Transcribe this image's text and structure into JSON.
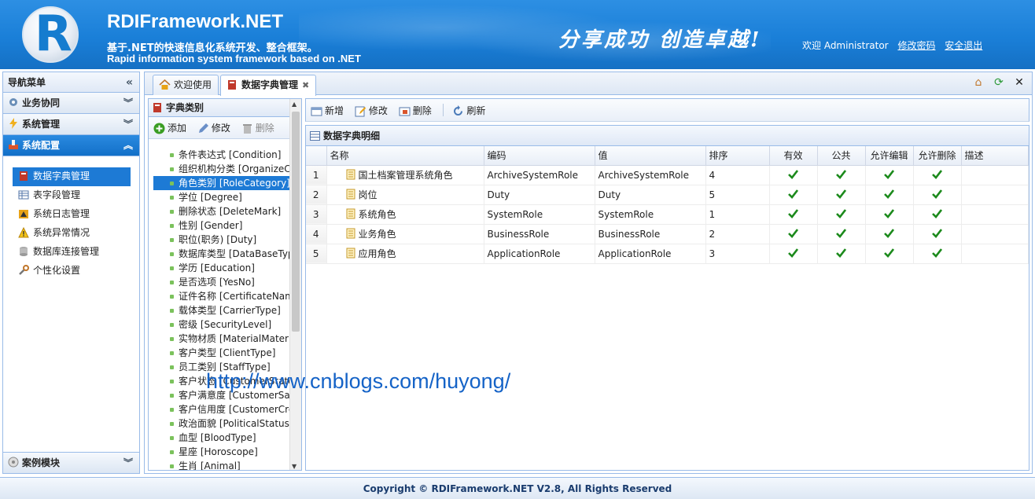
{
  "header": {
    "brand": "RDIFramework.NET",
    "tagline_cn": "基于.NET的快速信息化系统开发、整合框架。",
    "tagline_en": "Rapid information system framework based on .NET",
    "slogan": "分享成功  创造卓越!",
    "welcome": "欢迎 Administrator",
    "change_password": "修改密码",
    "logout": "安全退出"
  },
  "nav": {
    "title": "导航菜单",
    "sections": [
      {
        "label": "业务协同"
      },
      {
        "label": "系统管理"
      },
      {
        "label": "系统配置"
      }
    ],
    "items": [
      {
        "label": "数据字典管理"
      },
      {
        "label": "表字段管理"
      },
      {
        "label": "系统日志管理"
      },
      {
        "label": "系统异常情况"
      },
      {
        "label": "数据库连接管理"
      },
      {
        "label": "个性化设置"
      }
    ],
    "bottom_section": "案例模块"
  },
  "tabs": [
    {
      "label": "欢迎使用"
    },
    {
      "label": "数据字典管理"
    }
  ],
  "category": {
    "title": "字典类别",
    "add": "添加",
    "edit": "修改",
    "delete": "删除",
    "items": [
      "条件表达式 [Condition]",
      "组织机构分类 [OrganizeCategory]",
      "角色类别 [RoleCategory]",
      "学位 [Degree]",
      "删除状态 [DeleteMark]",
      "性别 [Gender]",
      "职位(职务) [Duty]",
      "数据库类型 [DataBaseType]",
      "学历 [Education]",
      "是否选项 [YesNo]",
      "证件名称 [CertificateName]",
      "载体类型 [CarrierType]",
      "密级 [SecurityLevel]",
      "实物材质 [MaterialMaterial]",
      "客户类型 [ClientType]",
      "员工类别 [StaffType]",
      "客户状态 [CustomerState]",
      "客户满意度 [CustomerSatisfaction]",
      "客户信用度 [CustomerCredit]",
      "政治面貌 [PoliticalStatus]",
      "血型 [BloodType]",
      "星座 [Horoscope]",
      "生肖 [Animal]"
    ]
  },
  "detail": {
    "toolbar": {
      "new": "新增",
      "edit": "修改",
      "delete": "删除",
      "refresh": "刷新"
    },
    "title": "数据字典明细",
    "columns": [
      "名称",
      "编码",
      "值",
      "排序",
      "有效",
      "公共",
      "允许编辑",
      "允许删除",
      "描述"
    ],
    "rows": [
      {
        "n": "1",
        "name": "国土档案管理系统角色",
        "code": "ArchiveSystemRole",
        "value": "ArchiveSystemRole",
        "sort": "4"
      },
      {
        "n": "2",
        "name": "岗位",
        "code": "Duty",
        "value": "Duty",
        "sort": "5"
      },
      {
        "n": "3",
        "name": "系统角色",
        "code": "SystemRole",
        "value": "SystemRole",
        "sort": "1"
      },
      {
        "n": "4",
        "name": "业务角色",
        "code": "BusinessRole",
        "value": "BusinessRole",
        "sort": "2"
      },
      {
        "n": "5",
        "name": "应用角色",
        "code": "ApplicationRole",
        "value": "ApplicationRole",
        "sort": "3"
      }
    ]
  },
  "watermark": "http://www.cnblogs.com/huyong/",
  "footer": "Copyright © RDIFramework.NET V2.8, All Rights Reserved",
  "colors": {
    "accent": "#1d7ad5",
    "border": "#99bbe8",
    "check": "#1c8a1c"
  }
}
